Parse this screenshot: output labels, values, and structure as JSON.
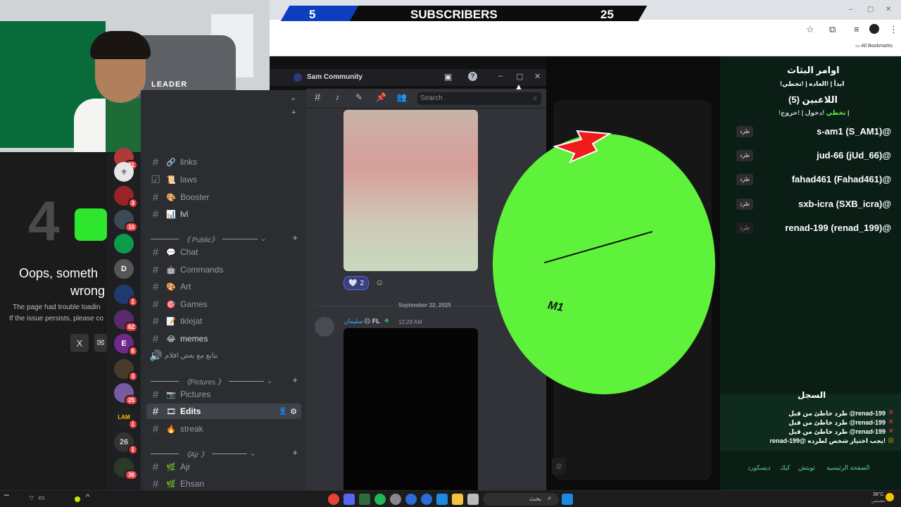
{
  "subscriber_bar": {
    "left_count": "5",
    "label": "SUBSCRIBERS",
    "right_count": "25"
  },
  "browser": {
    "all_bookmarks": "All Bookmarks"
  },
  "webcam": {
    "brand_text": "LEADER"
  },
  "error_page": {
    "code": "4",
    "title_line1": "Oops, someth",
    "title_line2": "wrong",
    "msg1": "The page had trouble loadin",
    "msg2": "If the issue persists, please co"
  },
  "discord": {
    "server_name": "Sam Community",
    "search_placeholder": "Search",
    "server_badges": [
      "31",
      "3",
      "10",
      "1",
      "62",
      "6",
      "3",
      "25",
      "1",
      "1",
      "36"
    ],
    "channels": [
      {
        "emoji": "🔗",
        "name": "links"
      },
      {
        "emoji": "📜",
        "name": "laws"
      },
      {
        "emoji": "🎨",
        "name": "Booster"
      },
      {
        "emoji": "📊",
        "name": "lvl"
      }
    ],
    "category_public": "《 Public》",
    "public_channels": [
      {
        "emoji": "💬",
        "name": "Chat"
      },
      {
        "emoji": "🤖",
        "name": "Commands"
      },
      {
        "emoji": "🎨",
        "name": "Art"
      },
      {
        "emoji": "🎯",
        "name": "Games"
      },
      {
        "emoji": "📝",
        "name": "tklejat"
      },
      {
        "emoji": "😂",
        "name": "memes"
      },
      {
        "emoji": "🎬",
        "name": "نتابع مع بعض افلام"
      }
    ],
    "category_pictures": "《Pictures 》",
    "pictures_channels": [
      {
        "emoji": "📷",
        "name": "Pictures"
      },
      {
        "emoji": "🎞",
        "name": "Edits"
      },
      {
        "emoji": "🔥",
        "name": "streak"
      }
    ],
    "category_ajr": "《Ajr 》",
    "ajr_channels": [
      {
        "emoji": "🌿",
        "name": "Ajr"
      },
      {
        "emoji": "🌿",
        "name": "Ehsan"
      }
    ],
    "reaction_count": "2",
    "date_divider": "September 22, 2025",
    "msg_author": "سليمان",
    "msg_tag": "FL",
    "msg_time": "12:28 AM"
  },
  "game": {
    "wheel_text": "M1"
  },
  "commands_panel": {
    "title": "اوامر البثاث",
    "subtitle": "!ابدأ | !العاده | !تخطي",
    "players_title": "اللاعبين (5)",
    "join_line_prefix": "!دخول | !خروج |",
    "join_line_highlight": "!تخطي",
    "kick_label": "طرد",
    "players": [
      "s-am1 (S_AM1)@",
      "jud-66 (jUd_66)@",
      "fahad461 (Fahad461)@",
      "sxb-icra (SXB_icra)@",
      "renad-199 (renad_199)@"
    ],
    "log_title": "السجل",
    "log_entries": [
      "طرد خاطئ من قبل @renad-199",
      "طرد خاطئ من قبل @renad-199",
      "طرد خاطئ من قبل @renad-199",
      "renad-199@ يجب اختيار شخص لطرده!"
    ],
    "footer_links": [
      "الصفحة الرئيسية",
      "تويتش",
      "كيك",
      "ديسكورد"
    ]
  },
  "taskbar": {
    "search_text": "بحث",
    "weather": "38°C",
    "weather_sub": "مشمس"
  }
}
